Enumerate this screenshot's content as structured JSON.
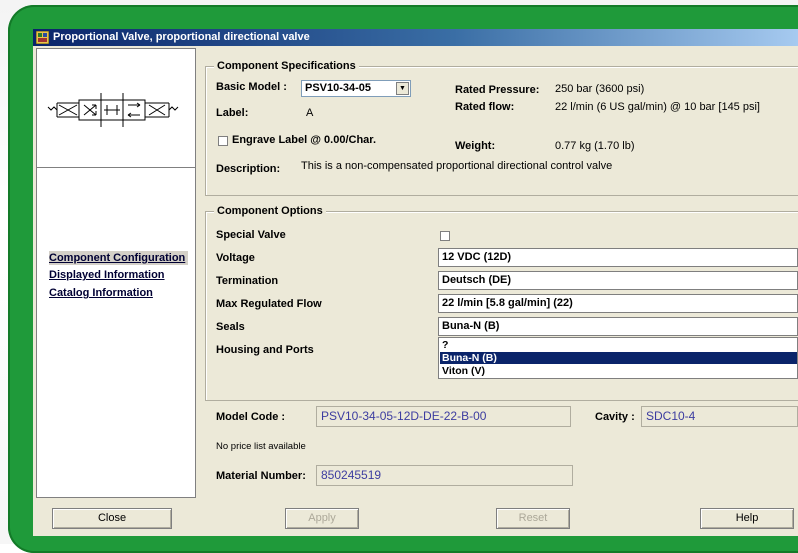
{
  "window": {
    "title": "Proportional Valve, proportional directional valve"
  },
  "nav": {
    "items": [
      {
        "label": "Component Configuration"
      },
      {
        "label": "Displayed Information"
      },
      {
        "label": "Catalog Information"
      }
    ],
    "close_label": "Close"
  },
  "specs": {
    "group_title": "Component Specifications",
    "basic_model_label": "Basic Model :",
    "basic_model_value": "PSV10-34-05",
    "label_label": "Label:",
    "label_value": "A",
    "engrave_label": "Engrave Label @ 0.00/Char.",
    "description_label": "Description:",
    "description_value": "This is a non-compensated proportional directional control valve",
    "rated_pressure_label": "Rated Pressure:",
    "rated_pressure_value": "250 bar (3600 psi)",
    "rated_flow_label": "Rated flow:",
    "rated_flow_value": "22 l/min (6 US gal/min) @ 10 bar [145 psi]",
    "weight_label": "Weight:",
    "weight_value": "0.77 kg (1.70 lb)"
  },
  "options": {
    "group_title": "Component Options",
    "special_valve_label": "Special Valve",
    "voltage_label": "Voltage",
    "voltage_value": "12 VDC (12D)",
    "termination_label": "Termination",
    "termination_value": "Deutsch (DE)",
    "max_flow_label": "Max Regulated Flow",
    "max_flow_value": "22 l/min [5.8 gal/min] (22)",
    "seals_label": "Seals",
    "seals_value": "Buna-N (B)",
    "housing_label": "Housing and Ports",
    "housing_options": [
      "?",
      "Buna-N (B)",
      "Viton (V)"
    ]
  },
  "footer": {
    "model_code_label": "Model Code :",
    "model_code_value": "PSV10-34-05-12D-DE-22-B-00",
    "cavity_label": "Cavity :",
    "cavity_value": "SDC10-4",
    "price_note": "No price list available",
    "material_number_label": "Material Number:",
    "material_number_value": "850245519",
    "apply_label": "Apply",
    "reset_label": "Reset",
    "help_label": "Help"
  }
}
